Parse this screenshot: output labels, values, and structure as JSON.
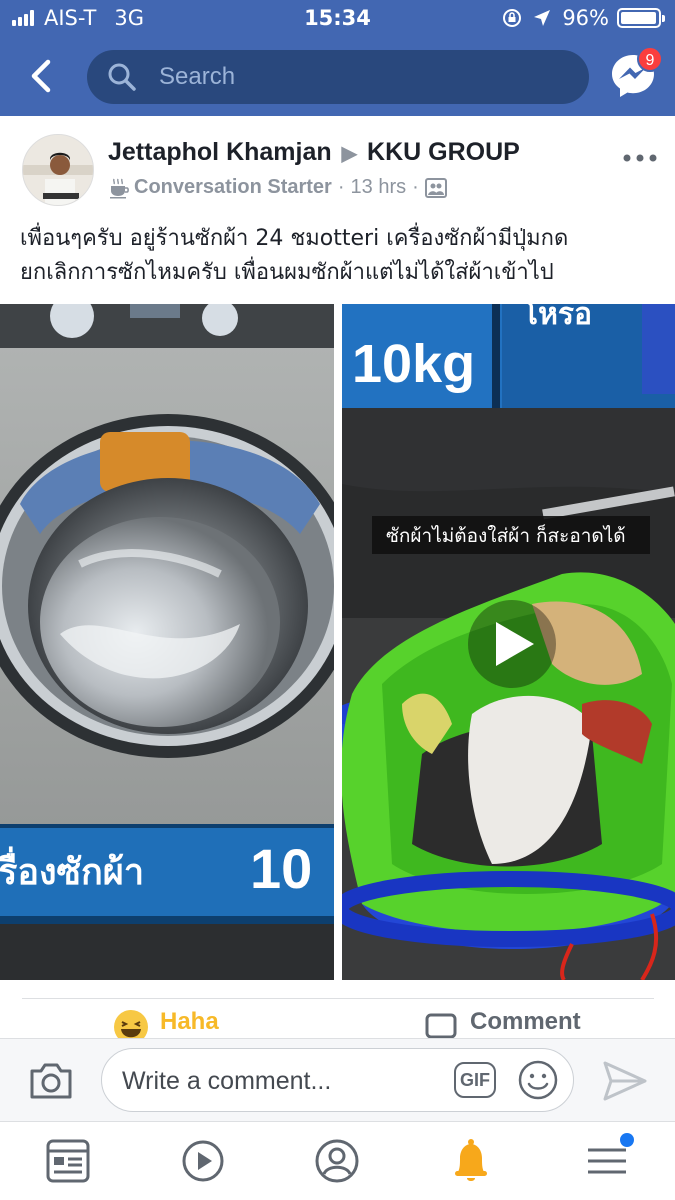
{
  "status_bar": {
    "carrier": "AIS-T",
    "network": "3G",
    "time": "15:34",
    "battery_percent": "96%",
    "battery_level": 0.96
  },
  "header": {
    "search_placeholder": "Search",
    "messenger_badge": "9"
  },
  "post": {
    "author": "Jettaphol Khamjan",
    "group": "KKU GROUP",
    "badge_icon": "coffee-cup-icon",
    "badge_label": "Conversation Starter",
    "time_ago": "13 hrs",
    "text_line1": "เพื่อนๆครับ อยู่ร้านซักผ้า 24 ชมotteri  เครื่องซักผ้ามีปุ่มกด",
    "text_line2": "ยกเลิกการซักไหมครับ เพื่อนผมซักผ้าแต่ไม่ได้ใส่ผ้าเข้าไป",
    "photo_left": {
      "machine_label": "รื่องซักผ้า",
      "machine_size": "10"
    },
    "photo_right": {
      "kg_label": "10kg",
      "sign_text": "โหรอ",
      "caption": "ซักผ้าไม่ต้องใส่ผ้า  ก็สะอาดได้"
    }
  },
  "actions": {
    "haha_label": "Haha",
    "comment_label": "Comment"
  },
  "composer": {
    "placeholder": "Write a comment...",
    "gif_label": "GIF"
  },
  "tabs": [
    {
      "icon": "news-feed-icon"
    },
    {
      "icon": "watch-video-icon"
    },
    {
      "icon": "profile-icon"
    },
    {
      "icon": "notifications-bell-icon"
    },
    {
      "icon": "menu-icon"
    }
  ],
  "colors": {
    "brand_blue": "#4267b2",
    "search_bg": "#29487d",
    "badge_red": "#fa3e3e",
    "haha_yellow": "#f7b928",
    "bell_orange": "#f7a81b",
    "menu_dot": "#1877f2"
  }
}
